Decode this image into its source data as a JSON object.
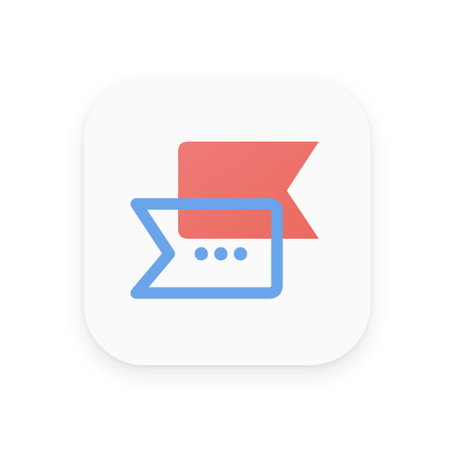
{
  "app_icon": {
    "icon_name": "flag-message-app-icon",
    "colors": {
      "tile_background": "#fafafa",
      "red_flag": "#ec7068",
      "blue_outline": "#6aa4ea",
      "dots": "#6aa4ea"
    }
  }
}
